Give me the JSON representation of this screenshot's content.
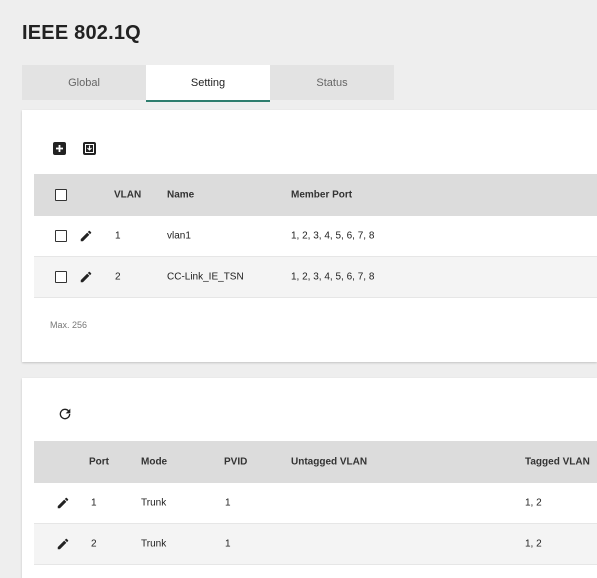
{
  "page": {
    "title": "IEEE 802.1Q"
  },
  "tabs": [
    {
      "label": "Global",
      "active": false
    },
    {
      "label": "Setting",
      "active": true
    },
    {
      "label": "Status",
      "active": false
    }
  ],
  "vlan_card": {
    "toolbar": {
      "add_icon": "add-box-icon",
      "import_icon": "import-box-icon"
    },
    "columns": {
      "vlan": "VLAN",
      "name": "Name",
      "member_port": "Member Port"
    },
    "rows": [
      {
        "vlan": "1",
        "name": "vlan1",
        "member_port": "1, 2, 3, 4, 5, 6, 7, 8"
      },
      {
        "vlan": "2",
        "name": "CC-Link_IE_TSN",
        "member_port": "1, 2, 3, 4, 5, 6, 7, 8"
      }
    ],
    "max_note": "Max. 256"
  },
  "port_card": {
    "toolbar": {
      "refresh_icon": "refresh-icon"
    },
    "columns": {
      "port": "Port",
      "mode": "Mode",
      "pvid": "PVID",
      "untagged_vlan": "Untagged VLAN",
      "tagged_vlan": "Tagged VLAN"
    },
    "rows": [
      {
        "port": "1",
        "mode": "Trunk",
        "pvid": "1",
        "untagged_vlan": "",
        "tagged_vlan": "1, 2"
      },
      {
        "port": "2",
        "mode": "Trunk",
        "pvid": "1",
        "untagged_vlan": "",
        "tagged_vlan": "1, 2"
      }
    ]
  },
  "colors": {
    "accent": "#2e7d6e",
    "header_bg": "#dcdcdc",
    "page_bg": "#eeeeee"
  }
}
